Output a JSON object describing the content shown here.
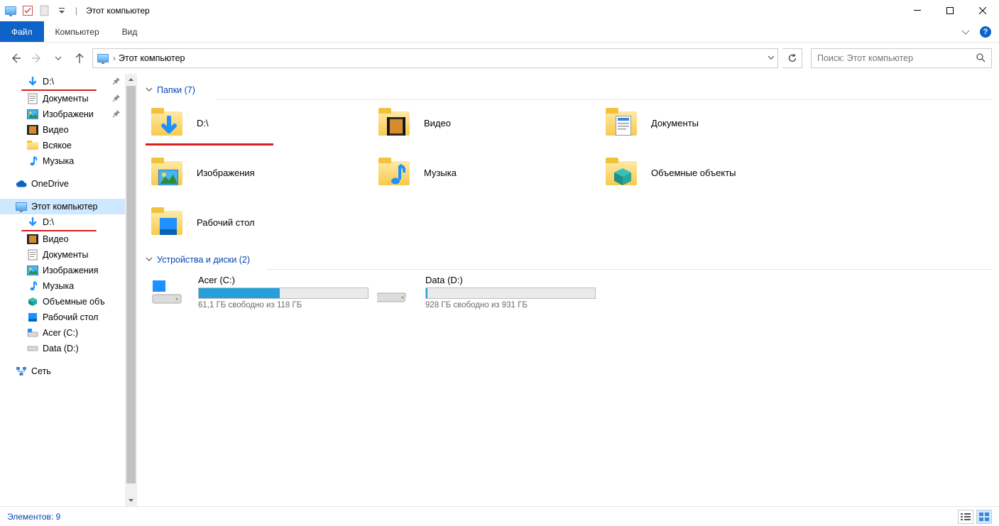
{
  "title": "Этот компьютер",
  "ribbon": {
    "file": "Файл",
    "tabs": [
      "Компьютер",
      "Вид"
    ]
  },
  "address": {
    "crumb": "Этот компьютер"
  },
  "search": {
    "placeholder": "Поиск: Этот компьютер"
  },
  "sidebar": {
    "quick": [
      {
        "label": "D:\\",
        "icon": "download",
        "pinned": true,
        "underline": true
      },
      {
        "label": "Документы",
        "icon": "doc",
        "pinned": true
      },
      {
        "label": "Изображени",
        "icon": "image",
        "pinned": true
      },
      {
        "label": "Видео",
        "icon": "video"
      },
      {
        "label": "Всякое",
        "icon": "folder"
      },
      {
        "label": "Музыка",
        "icon": "music"
      }
    ],
    "onedrive": {
      "label": "OneDrive"
    },
    "thispc": {
      "label": "Этот компьютер",
      "selected": true
    },
    "thispc_children": [
      {
        "label": "D:\\",
        "icon": "download",
        "underline": true
      },
      {
        "label": "Видео",
        "icon": "video"
      },
      {
        "label": "Документы",
        "icon": "doc"
      },
      {
        "label": "Изображения",
        "icon": "image"
      },
      {
        "label": "Музыка",
        "icon": "music"
      },
      {
        "label": "Объемные объ",
        "icon": "cube"
      },
      {
        "label": "Рабочий стол",
        "icon": "desktop"
      },
      {
        "label": "Acer (C:)",
        "icon": "drive-c"
      },
      {
        "label": "Data (D:)",
        "icon": "drive"
      }
    ],
    "network": {
      "label": "Сеть"
    }
  },
  "content": {
    "folders_header": "Папки (7)",
    "folders": [
      {
        "label": "D:\\",
        "icon": "download",
        "underline": true
      },
      {
        "label": "Видео",
        "icon": "video"
      },
      {
        "label": "Документы",
        "icon": "doc"
      },
      {
        "label": "Изображения",
        "icon": "image"
      },
      {
        "label": "Музыка",
        "icon": "music"
      },
      {
        "label": "Объемные объекты",
        "icon": "cube"
      },
      {
        "label": "Рабочий стол",
        "icon": "desktop"
      }
    ],
    "drives_header": "Устройства и диски (2)",
    "drives": [
      {
        "name": "Acer (C:)",
        "fill_pct": 48,
        "sub": "61,1 ГБ свободно из 118 ГБ",
        "os": true
      },
      {
        "name": "Data (D:)",
        "fill_pct": 1,
        "sub": "928 ГБ свободно из 931 ГБ",
        "os": false
      }
    ]
  },
  "status": {
    "count_label": "Элементов: 9"
  },
  "annotation_color": "#d81e1e"
}
